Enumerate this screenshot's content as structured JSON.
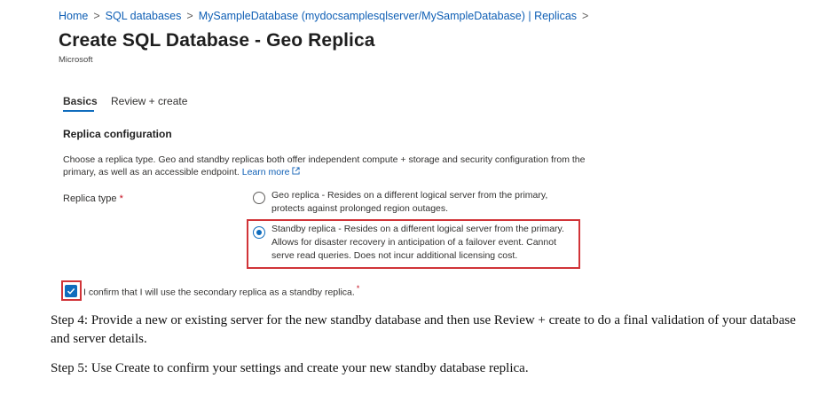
{
  "breadcrumb": {
    "items": [
      "Home",
      "SQL databases",
      "MySampleDatabase (mydocsamplesqlserver/MySampleDatabase) | Replicas"
    ],
    "separator": ">"
  },
  "header": {
    "title": "Create SQL Database - Geo Replica",
    "more": "...",
    "publisher": "Microsoft"
  },
  "tabs": [
    {
      "label": "Basics",
      "active": true
    },
    {
      "label": "Review + create",
      "active": false
    }
  ],
  "section": {
    "title": "Replica configuration",
    "description": "Choose a replica type. Geo and standby replicas both offer independent compute + storage and security configuration from the primary, as well as an accessible endpoint.",
    "learn_more": "Learn more",
    "learn_more_icon": "external-link-icon"
  },
  "replica_type": {
    "label": "Replica type",
    "required_mark": "*",
    "options": [
      {
        "line1": "Geo replica - Resides on a different logical server from the primary,",
        "line2": "protects against prolonged region outages.",
        "selected": false
      },
      {
        "line1": "Standby replica - Resides on a different logical server from the primary.",
        "line2": "Allows for disaster recovery in anticipation of a failover event. Cannot",
        "line3": "serve read queries. Does not incur additional licensing cost.",
        "selected": true
      }
    ]
  },
  "confirm": {
    "text": "I confirm that I will use the secondary replica as a standby replica.",
    "required_mark": "*",
    "checked": true
  },
  "steps": {
    "step4": "Step 4: Provide a new or existing server for the new standby database and then use Review + create to do a final validation of your database and server details.",
    "step5": "Step 5: Use Create to confirm your settings and create your new standby database replica."
  },
  "colors": {
    "link": "#0f5fb5",
    "accent": "#0f6cbd",
    "highlight": "#d13438",
    "required": "#c50f1f"
  }
}
